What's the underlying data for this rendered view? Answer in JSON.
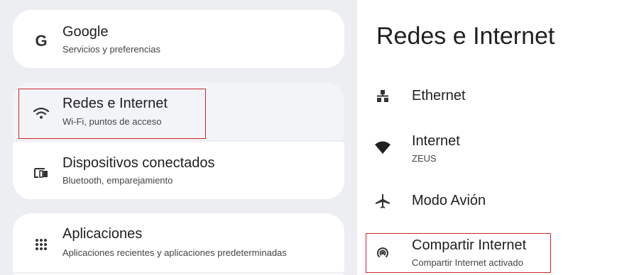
{
  "settings_menu": {
    "items": [
      {
        "icon": "google-g-icon",
        "glyph": "G",
        "title": "Google",
        "subtitle": "Servicios y preferencias"
      },
      {
        "icon": "wifi-icon",
        "title": "Redes e Internet",
        "subtitle": "Wi-Fi, puntos de acceso"
      },
      {
        "icon": "connected-devices-icon",
        "title": "Dispositivos conectados",
        "subtitle": "Bluetooth, emparejamiento"
      },
      {
        "icon": "apps-grid-icon",
        "title": "Aplicaciones",
        "subtitle": "Aplicaciones recientes y aplicaciones predeterminadas"
      }
    ]
  },
  "detail_pane": {
    "title": "Redes e Internet",
    "items": [
      {
        "icon": "ethernet-icon",
        "title": "Ethernet"
      },
      {
        "icon": "wifi-signal-icon",
        "title": "Internet",
        "subtitle": "ZEUS"
      },
      {
        "icon": "airplane-icon",
        "title": "Modo Avión"
      },
      {
        "icon": "hotspot-icon",
        "title": "Compartir Internet",
        "subtitle": "Compartir Internet activado"
      }
    ]
  },
  "colors": {
    "left_background": "#eceef2",
    "card_background": "#ffffff",
    "highlight_border": "#d0252b",
    "text_primary": "#1f1f1f",
    "text_secondary": "#444444"
  }
}
